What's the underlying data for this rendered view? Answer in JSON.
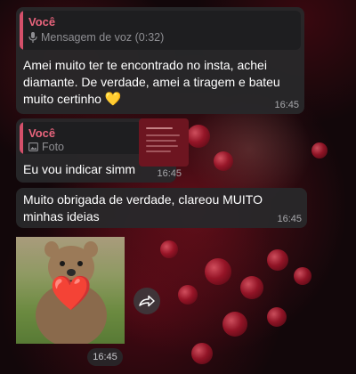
{
  "messages": [
    {
      "reply": {
        "author": "Você",
        "type_label": "Mensagem de voz (0:32)",
        "icon": "microphone-icon"
      },
      "text": "Amei muito ter te encontrado no insta, achei diamante. De verdade, amei a tiragem e bateu muito certinho",
      "emoji": "💛",
      "time": "16:45"
    },
    {
      "reply": {
        "author": "Você",
        "type_label": "Foto",
        "icon": "image-icon"
      },
      "text": "Eu vou indicar simm",
      "time": "16:45"
    },
    {
      "text": "Muito obrigada de verdade, clareou MUITO minhas ideias",
      "time": "16:45"
    },
    {
      "media": "photo",
      "emoji": "❤️",
      "time": "16:45"
    }
  ],
  "colors": {
    "bubble": "#28282a",
    "reply_accent": "#d4506a",
    "author": "#e8647c"
  }
}
